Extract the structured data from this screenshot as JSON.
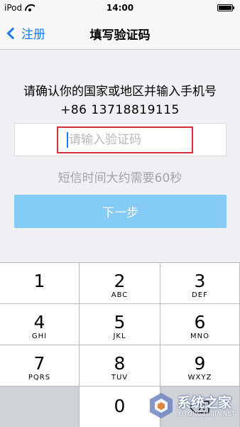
{
  "status_bar": {
    "carrier": "iPod",
    "time": "14:00"
  },
  "nav": {
    "back_label": "注册",
    "title": "填写验证码"
  },
  "prompt": "请确认你的国家或地区并输入手机号",
  "phone": "+86  13718819115",
  "code_input": {
    "placeholder": "请输入验证码",
    "value": ""
  },
  "hint": "短信时间大约需要60秒",
  "next_button": "下一步",
  "keypad": {
    "k1": {
      "num": "1",
      "letters": ""
    },
    "k2": {
      "num": "2",
      "letters": "ABC"
    },
    "k3": {
      "num": "3",
      "letters": "DEF"
    },
    "k4": {
      "num": "4",
      "letters": "GHI"
    },
    "k5": {
      "num": "5",
      "letters": "JKL"
    },
    "k6": {
      "num": "6",
      "letters": "MNO"
    },
    "k7": {
      "num": "7",
      "letters": "PQRS"
    },
    "k8": {
      "num": "8",
      "letters": "TUV"
    },
    "k9": {
      "num": "9",
      "letters": "WXYZ"
    },
    "k0": {
      "num": "0"
    }
  },
  "watermark": {
    "text": "系统之家",
    "sub": "XITONGZHIJIA.NET"
  },
  "colors": {
    "accent": "#1e7bf6",
    "button": "#84cbf5",
    "highlight_border": "#d7303a"
  },
  "icons": {
    "back": "chevron-left-icon",
    "wifi": "wifi-icon",
    "battery": "battery-icon",
    "delete": "backspace-icon"
  }
}
